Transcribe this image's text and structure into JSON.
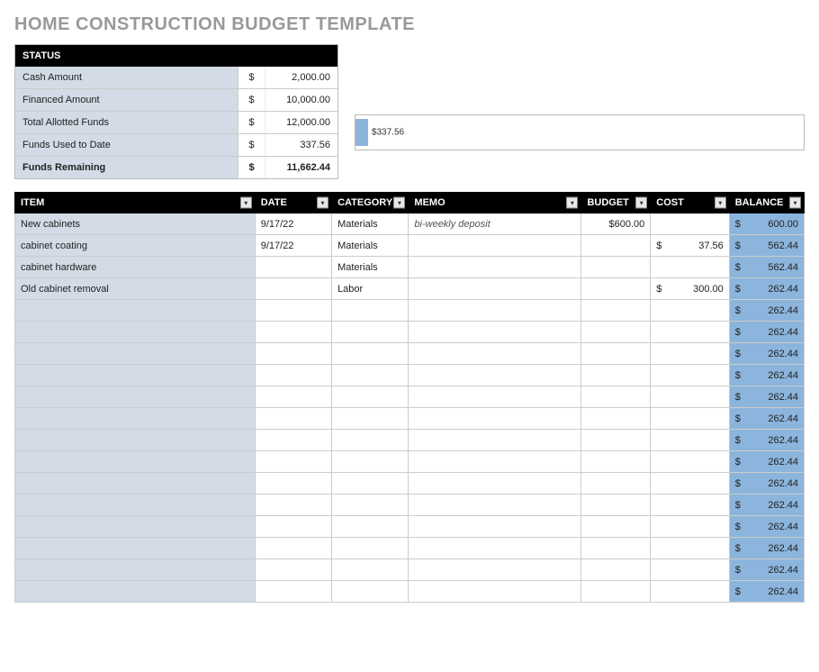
{
  "title": "HOME CONSTRUCTION BUDGET TEMPLATE",
  "status": {
    "header": "STATUS",
    "rows": [
      {
        "label": "Cash Amount",
        "cur": "$",
        "val": "2,000.00",
        "bold": false
      },
      {
        "label": "Financed Amount",
        "cur": "$",
        "val": "10,000.00",
        "bold": false
      },
      {
        "label": "Total Allotted Funds",
        "cur": "$",
        "val": "12,000.00",
        "bold": false
      },
      {
        "label": "Funds Used to Date",
        "cur": "$",
        "val": "337.56",
        "bold": false
      },
      {
        "label": "Funds Remaining",
        "cur": "$",
        "val": "11,662.44",
        "bold": true
      }
    ]
  },
  "chart_data": {
    "type": "bar",
    "title": "",
    "categories": [
      "Funds Used to Date"
    ],
    "values": [
      337.56
    ],
    "value_label": "$337.56",
    "xlim": [
      0,
      12000
    ],
    "bar_fraction": 0.028
  },
  "columns": {
    "item": "ITEM",
    "date": "DATE",
    "category": "CATEGORY",
    "memo": "MEMO",
    "budget": "BUDGET",
    "cost": "COST",
    "balance": "BALANCE"
  },
  "rows": [
    {
      "item": "New cabinets",
      "date": "9/17/22",
      "category": "Materials",
      "memo": "bi-weekly deposit",
      "budget": "$600.00",
      "cost_cur": "",
      "cost": "",
      "bal_cur": "$",
      "balance": "600.00"
    },
    {
      "item": "cabinet coating",
      "date": "9/17/22",
      "category": "Materials",
      "memo": "",
      "budget": "",
      "cost_cur": "$",
      "cost": "37.56",
      "bal_cur": "$",
      "balance": "562.44"
    },
    {
      "item": "cabinet hardware",
      "date": "",
      "category": "Materials",
      "memo": "",
      "budget": "",
      "cost_cur": "",
      "cost": "",
      "bal_cur": "$",
      "balance": "562.44"
    },
    {
      "item": "Old cabinet removal",
      "date": "",
      "category": "Labor",
      "memo": "",
      "budget": "",
      "cost_cur": "$",
      "cost": "300.00",
      "bal_cur": "$",
      "balance": "262.44"
    },
    {
      "item": "",
      "date": "",
      "category": "",
      "memo": "",
      "budget": "",
      "cost_cur": "",
      "cost": "",
      "bal_cur": "$",
      "balance": "262.44"
    },
    {
      "item": "",
      "date": "",
      "category": "",
      "memo": "",
      "budget": "",
      "cost_cur": "",
      "cost": "",
      "bal_cur": "$",
      "balance": "262.44"
    },
    {
      "item": "",
      "date": "",
      "category": "",
      "memo": "",
      "budget": "",
      "cost_cur": "",
      "cost": "",
      "bal_cur": "$",
      "balance": "262.44"
    },
    {
      "item": "",
      "date": "",
      "category": "",
      "memo": "",
      "budget": "",
      "cost_cur": "",
      "cost": "",
      "bal_cur": "$",
      "balance": "262.44"
    },
    {
      "item": "",
      "date": "",
      "category": "",
      "memo": "",
      "budget": "",
      "cost_cur": "",
      "cost": "",
      "bal_cur": "$",
      "balance": "262.44"
    },
    {
      "item": "",
      "date": "",
      "category": "",
      "memo": "",
      "budget": "",
      "cost_cur": "",
      "cost": "",
      "bal_cur": "$",
      "balance": "262.44"
    },
    {
      "item": "",
      "date": "",
      "category": "",
      "memo": "",
      "budget": "",
      "cost_cur": "",
      "cost": "",
      "bal_cur": "$",
      "balance": "262.44"
    },
    {
      "item": "",
      "date": "",
      "category": "",
      "memo": "",
      "budget": "",
      "cost_cur": "",
      "cost": "",
      "bal_cur": "$",
      "balance": "262.44"
    },
    {
      "item": "",
      "date": "",
      "category": "",
      "memo": "",
      "budget": "",
      "cost_cur": "",
      "cost": "",
      "bal_cur": "$",
      "balance": "262.44"
    },
    {
      "item": "",
      "date": "",
      "category": "",
      "memo": "",
      "budget": "",
      "cost_cur": "",
      "cost": "",
      "bal_cur": "$",
      "balance": "262.44"
    },
    {
      "item": "",
      "date": "",
      "category": "",
      "memo": "",
      "budget": "",
      "cost_cur": "",
      "cost": "",
      "bal_cur": "$",
      "balance": "262.44"
    },
    {
      "item": "",
      "date": "",
      "category": "",
      "memo": "",
      "budget": "",
      "cost_cur": "",
      "cost": "",
      "bal_cur": "$",
      "balance": "262.44"
    },
    {
      "item": "",
      "date": "",
      "category": "",
      "memo": "",
      "budget": "",
      "cost_cur": "",
      "cost": "",
      "bal_cur": "$",
      "balance": "262.44"
    },
    {
      "item": "",
      "date": "",
      "category": "",
      "memo": "",
      "budget": "",
      "cost_cur": "",
      "cost": "",
      "bal_cur": "$",
      "balance": "262.44"
    }
  ]
}
